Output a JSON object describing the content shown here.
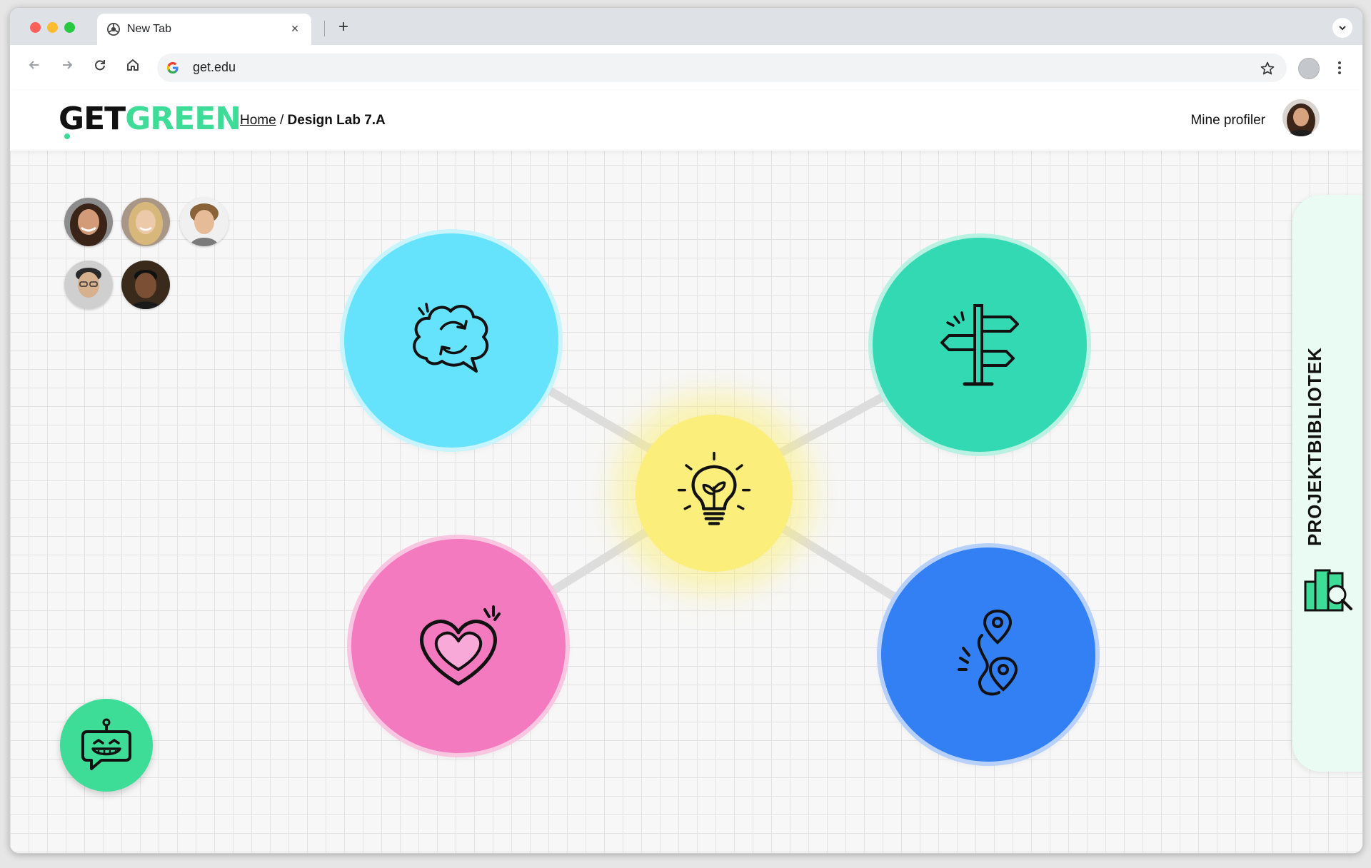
{
  "browser": {
    "tab_title": "New Tab",
    "tab_close": "×",
    "new_tab": "+",
    "url": "get.edu"
  },
  "site": {
    "logo_part1": "GET",
    "logo_part2": "GREEN",
    "breadcrumb_home": "Home",
    "breadcrumb_separator": " / ",
    "breadcrumb_current": "Design Lab 7.A",
    "profile_link": "Mine profiler"
  },
  "side_panel": {
    "label": "PROJEKTBIBLIOTEK"
  },
  "colors": {
    "brand_green": "#3ddc97",
    "node_brain": "#66e3fc",
    "node_signpost": "#33d9b2",
    "node_idea": "#fbee7b",
    "node_heart": "#f47ac0",
    "node_route": "#3380f5"
  },
  "icons": [
    "brain-icon",
    "signpost-icon",
    "lightbulb-icon",
    "heart-icon",
    "route-icon",
    "chatbot-icon",
    "library-icon"
  ]
}
